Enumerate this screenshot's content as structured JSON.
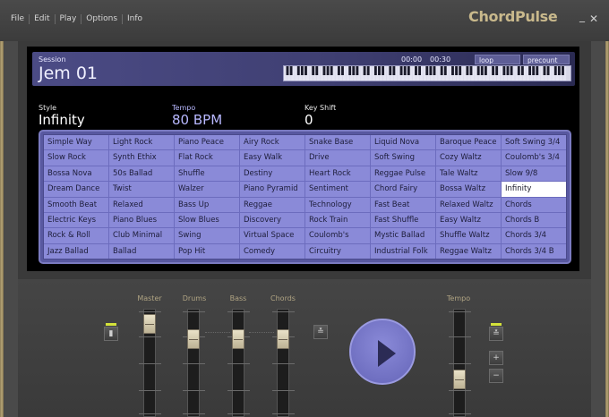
{
  "menu": [
    "File",
    "Edit",
    "Play",
    "Options",
    "Info"
  ],
  "app_title": "ChordPulse",
  "window_buttons": {
    "minimize": "_",
    "close": "✕"
  },
  "session": {
    "label": "Session",
    "name": "Jem 01",
    "time_start": "00:00",
    "time_end": "00:30",
    "loop_label": "loop region",
    "precount_label": "precount off"
  },
  "fields": {
    "style_label": "Style",
    "style_value": "Infinity",
    "tempo_label": "Tempo",
    "tempo_value": "80 BPM",
    "key_label": "Key Shift",
    "key_value": "0"
  },
  "styles": [
    [
      "Simple Way",
      "Light Rock",
      "Piano Peace",
      "Airy Rock",
      "Snake Base",
      "Liquid Nova",
      "Baroque Peace",
      "Soft Swing 3/4"
    ],
    [
      "Slow Rock",
      "Synth Ethix",
      "Flat Rock",
      "Easy Walk",
      "Drive",
      "Soft Swing",
      "Cozy Waltz",
      "Coulomb's 3/4"
    ],
    [
      "Bossa Nova",
      "50s Ballad",
      "Shuffle",
      "Destiny",
      "Heart Rock",
      "Reggae Pulse",
      "Tale Waltz",
      "Slow 9/8"
    ],
    [
      "Dream Dance",
      "Twist",
      "Walzer",
      "Piano Pyramid",
      "Sentiment",
      "Chord Fairy",
      "Bossa Waltz",
      "Infinity"
    ],
    [
      "Smooth Beat",
      "Relaxed",
      "Bass Up",
      "Reggae",
      "Technology",
      "Fast Beat",
      "Relaxed Waltz",
      "Chords"
    ],
    [
      "Electric Keys",
      "Piano Blues",
      "Slow Blues",
      "Discovery",
      "Rock Train",
      "Fast Shuffle",
      "Easy Waltz",
      "Chords B"
    ],
    [
      "Rock & Roll",
      "Club Minimal",
      "Swing",
      "Virtual Space",
      "Coulomb's",
      "Mystic Ballad",
      "Shuffle Waltz",
      "Chords 3/4"
    ],
    [
      "Jazz Ballad",
      "Ballad",
      "Pop Hit",
      "Comedy",
      "Circuitry",
      "Industrial Folk",
      "Reggae Waltz",
      "Chords 3/4 B"
    ]
  ],
  "selected_style": "Infinity",
  "mixer": {
    "channels": [
      {
        "label": "Master",
        "level": 0.95
      },
      {
        "label": "Drums",
        "level": 0.78
      },
      {
        "label": "Bass",
        "level": 0.78
      },
      {
        "label": "Chords",
        "level": 0.78
      }
    ],
    "tempo_label": "Tempo",
    "tempo_level": 0.32,
    "plus_label": "+",
    "minus_label": "−"
  },
  "colors": {
    "screen_bg": "#000000",
    "accent_purple": "#8a8ad8",
    "selected_cell": "#ffffff",
    "brand_gold": "#c9b98c",
    "led_green": "#d4e23a"
  },
  "icons": {
    "speaker": "speaker-icon",
    "sync_left": "sync-icon",
    "sync_right": "sync-icon",
    "play": "play-icon"
  }
}
